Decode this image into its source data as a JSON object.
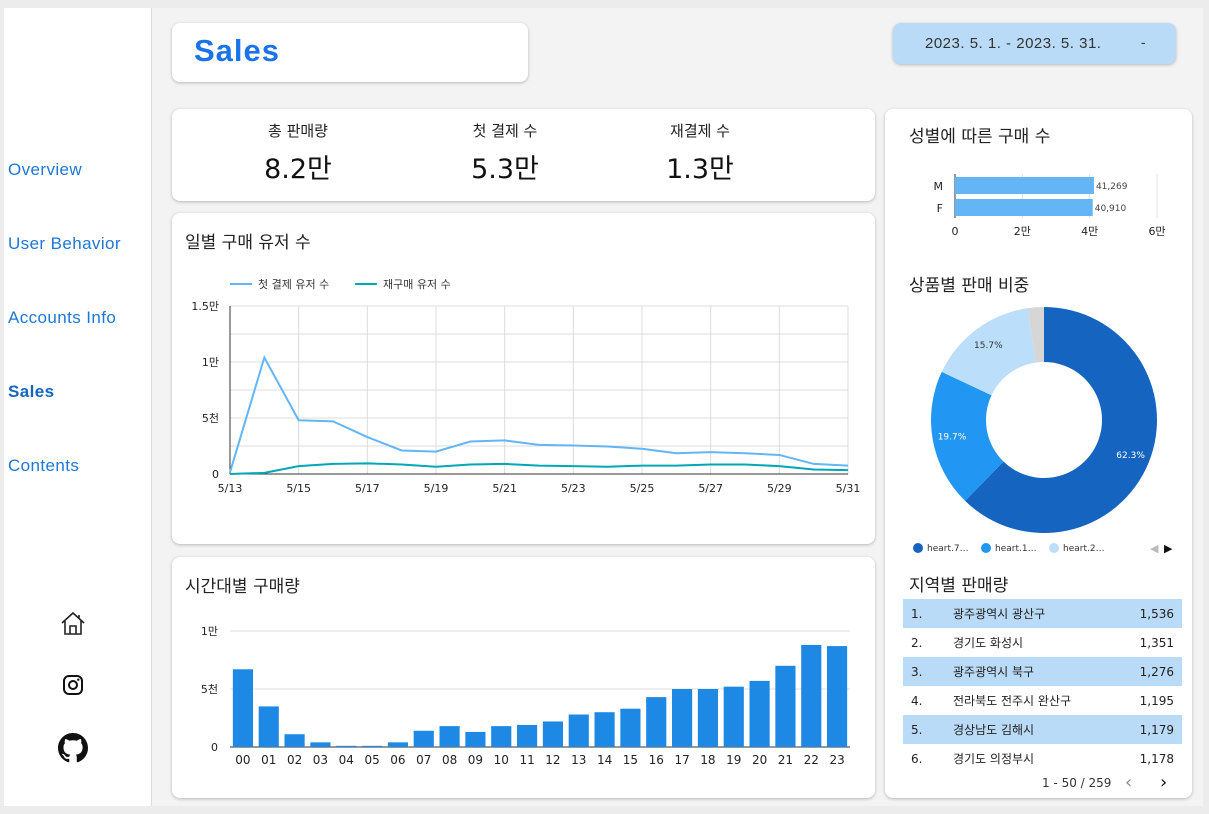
{
  "sidebar": {
    "items": [
      {
        "label": "Overview"
      },
      {
        "label": "User Behavior"
      },
      {
        "label": "Accounts Info"
      },
      {
        "label": "Sales"
      },
      {
        "label": "Contents"
      }
    ],
    "icons": [
      "home-icon",
      "instagram-icon",
      "github-icon"
    ]
  },
  "header": {
    "title": "Sales",
    "date_range": "2023. 5. 1. - 2023. 5. 31.",
    "date_caret": "-"
  },
  "kpis": [
    {
      "label": "총 판매량",
      "value": "8.2만"
    },
    {
      "label": "첫 결제 수",
      "value": "5.3만"
    },
    {
      "label": "재결제 수",
      "value": "1.3만"
    }
  ],
  "daily_users": {
    "title": "일별 구매 유저 수",
    "chart_data": {
      "type": "line",
      "x": [
        "5/13",
        "5/14",
        "5/15",
        "5/16",
        "5/17",
        "5/18",
        "5/19",
        "5/20",
        "5/21",
        "5/22",
        "5/23",
        "5/24",
        "5/25",
        "5/26",
        "5/27",
        "5/28",
        "5/29",
        "5/30",
        "5/31"
      ],
      "x_tick_labels": [
        "5/13",
        "5/15",
        "5/17",
        "5/19",
        "5/21",
        "5/23",
        "5/25",
        "5/27",
        "5/29",
        "5/31"
      ],
      "series": [
        {
          "name": "첫 결제 유저 수",
          "color": "#64b5f6",
          "values": [
            150,
            10400,
            4800,
            4700,
            3300,
            2100,
            2000,
            2900,
            3000,
            2600,
            2550,
            2450,
            2250,
            1850,
            1950,
            1850,
            1700,
            900,
            750
          ]
        },
        {
          "name": "재구매 유저 수",
          "color": "#00a7b5",
          "values": [
            0,
            100,
            700,
            900,
            950,
            850,
            650,
            850,
            900,
            750,
            700,
            650,
            750,
            750,
            850,
            850,
            700,
            400,
            350
          ]
        }
      ],
      "y_ticks": [
        {
          "v": 0,
          "label": "0"
        },
        {
          "v": 5000,
          "label": "5천"
        },
        {
          "v": 10000,
          "label": "1만"
        },
        {
          "v": 15000,
          "label": "1.5만"
        }
      ],
      "ylim": [
        0,
        15000
      ],
      "grid": true,
      "legend": "top-left"
    }
  },
  "hourly": {
    "title": "시간대별 구매량",
    "chart_data": {
      "type": "bar",
      "categories": [
        "00",
        "01",
        "02",
        "03",
        "04",
        "05",
        "06",
        "07",
        "08",
        "09",
        "10",
        "11",
        "12",
        "13",
        "14",
        "15",
        "16",
        "17",
        "18",
        "19",
        "20",
        "21",
        "22",
        "23"
      ],
      "values": [
        6700,
        3500,
        1100,
        400,
        100,
        100,
        400,
        1400,
        1800,
        1300,
        1800,
        1900,
        2200,
        2800,
        3000,
        3300,
        4300,
        5000,
        5000,
        5200,
        5700,
        7000,
        8800,
        8700
      ],
      "color": "#1e88e5",
      "y_ticks": [
        {
          "v": 0,
          "label": "0"
        },
        {
          "v": 5000,
          "label": "5천"
        },
        {
          "v": 10000,
          "label": "1만"
        }
      ],
      "ylim": [
        0,
        10000
      ],
      "grid": true
    }
  },
  "gender": {
    "title": "성별에 따른 구매 수",
    "chart_data": {
      "type": "bar",
      "orientation": "horizontal",
      "categories": [
        "M",
        "F"
      ],
      "values": [
        41269,
        40910
      ],
      "value_labels": [
        "41,269",
        "40,910"
      ],
      "color": "#64b5f6",
      "x_ticks": [
        {
          "v": 0,
          "label": "0"
        },
        {
          "v": 20000,
          "label": "2만"
        },
        {
          "v": 40000,
          "label": "4만"
        },
        {
          "v": 60000,
          "label": "6만"
        }
      ],
      "xlim": [
        0,
        60000
      ]
    }
  },
  "product_share": {
    "title": "상품별 판매 비중",
    "chart_data": {
      "type": "pie",
      "donut": true,
      "slices": [
        {
          "name": "heart.7…",
          "value": 62.3,
          "label": "62.3%",
          "color": "#1565c0"
        },
        {
          "name": "heart.1…",
          "value": 19.7,
          "label": "19.7%",
          "color": "#2196f3"
        },
        {
          "name": "heart.2…",
          "value": 15.7,
          "label": "15.7%",
          "color": "#bbdefb"
        },
        {
          "name": "",
          "value": 2.3,
          "label": "",
          "color": "#d6d6d6"
        }
      ],
      "legend": "bottom"
    },
    "legend_nav_prev": "◀",
    "legend_nav_next": "▶"
  },
  "regions": {
    "title": "지역별 판매량",
    "rows": [
      {
        "rank": "1.",
        "name": "광주광역시 광산구",
        "value": "1,536"
      },
      {
        "rank": "2.",
        "name": "경기도 화성시",
        "value": "1,351"
      },
      {
        "rank": "3.",
        "name": "광주광역시 북구",
        "value": "1,276"
      },
      {
        "rank": "4.",
        "name": "전라북도 전주시 완산구",
        "value": "1,195"
      },
      {
        "rank": "5.",
        "name": "경상남도 김해시",
        "value": "1,179"
      },
      {
        "rank": "6.",
        "name": "경기도 의정부시",
        "value": "1,178"
      }
    ],
    "pager_text": "1 - 50 / 259",
    "prev": "‹",
    "next": "›"
  }
}
